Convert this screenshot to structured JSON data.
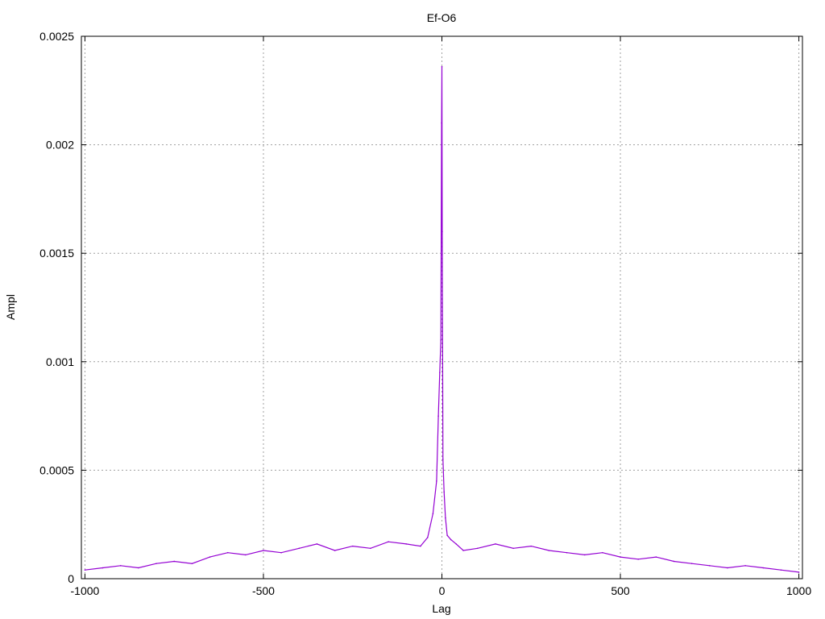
{
  "chart_data": {
    "type": "line",
    "title": "Ef-O6",
    "xlabel": "Lag",
    "ylabel": "Ampl",
    "xlim": [
      -1010,
      1010
    ],
    "ylim": [
      0,
      0.0025
    ],
    "x_ticks": [
      -1000,
      -500,
      0,
      500,
      1000
    ],
    "x_tick_labels": [
      "-1000",
      "-500",
      "0",
      "500",
      "1000"
    ],
    "y_ticks": [
      0,
      0.0005,
      0.001,
      0.0015,
      0.002,
      0.0025
    ],
    "y_tick_labels": [
      "0",
      "0.0005",
      "0.001",
      "0.0015",
      "0.002",
      "0.0025"
    ],
    "grid": true,
    "legend": "none",
    "series_color": "#9400d3",
    "series": [
      {
        "x": [
          -1000,
          -950,
          -900,
          -850,
          -800,
          -750,
          -700,
          -650,
          -600,
          -550,
          -500,
          -450,
          -400,
          -350,
          -300,
          -250,
          -200,
          -150,
          -100,
          -60,
          -40,
          -25,
          -15,
          -10,
          -6,
          -3,
          -1,
          0,
          1,
          3,
          6,
          10,
          15,
          25,
          40,
          60,
          100,
          150,
          200,
          250,
          300,
          350,
          400,
          450,
          500,
          550,
          600,
          650,
          700,
          750,
          800,
          850,
          900,
          950,
          1000
        ],
        "values": [
          4e-05,
          5e-05,
          6e-05,
          5e-05,
          7e-05,
          8e-05,
          7e-05,
          0.0001,
          0.00012,
          0.00011,
          0.00013,
          0.00012,
          0.00014,
          0.00016,
          0.00013,
          0.00015,
          0.00014,
          0.00017,
          0.00016,
          0.00015,
          0.00019,
          0.0003,
          0.00045,
          0.00075,
          0.00095,
          0.0011,
          0.0021,
          0.00236,
          0.0016,
          0.00055,
          0.0004,
          0.00028,
          0.0002,
          0.00018,
          0.00016,
          0.00013,
          0.00014,
          0.00016,
          0.00014,
          0.00015,
          0.00013,
          0.00012,
          0.00011,
          0.00012,
          0.0001,
          9e-05,
          0.0001,
          8e-05,
          7e-05,
          6e-05,
          5e-05,
          6e-05,
          5e-05,
          4e-05,
          3e-05
        ]
      }
    ]
  }
}
